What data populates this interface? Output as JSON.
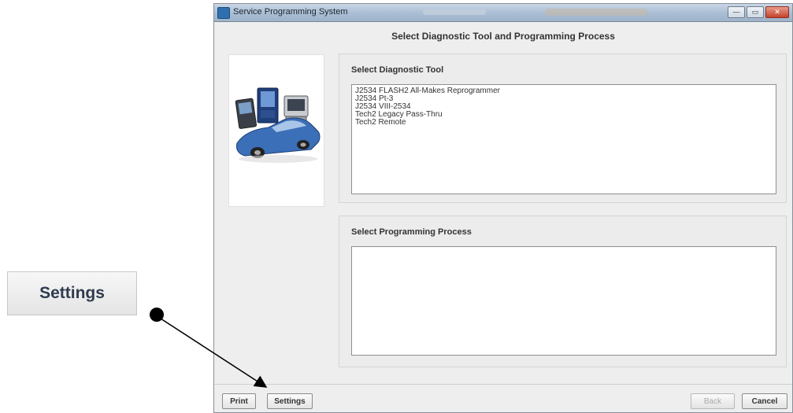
{
  "callout": {
    "label": "Settings"
  },
  "window": {
    "title": "Service Programming System",
    "header": "Select Diagnostic Tool and Programming Process",
    "controls": {
      "minimize": "—",
      "maximize": "▭",
      "close": "✕"
    }
  },
  "tool_group": {
    "label": "Select Diagnostic Tool",
    "items": [
      "J2534 FLASH2 All-Makes Reprogrammer",
      "J2534 Pt-3",
      "J2534 VIII-2534",
      "Tech2 Legacy Pass-Thru",
      "Tech2 Remote"
    ]
  },
  "process_group": {
    "label": "Select Programming Process",
    "items": []
  },
  "buttons": {
    "print": "Print",
    "settings": "Settings",
    "back": "Back",
    "cancel": "Cancel"
  },
  "colors": {
    "arrow": "#000000",
    "titlebar": "#a9bdd3",
    "car": "#3b6fb8"
  }
}
